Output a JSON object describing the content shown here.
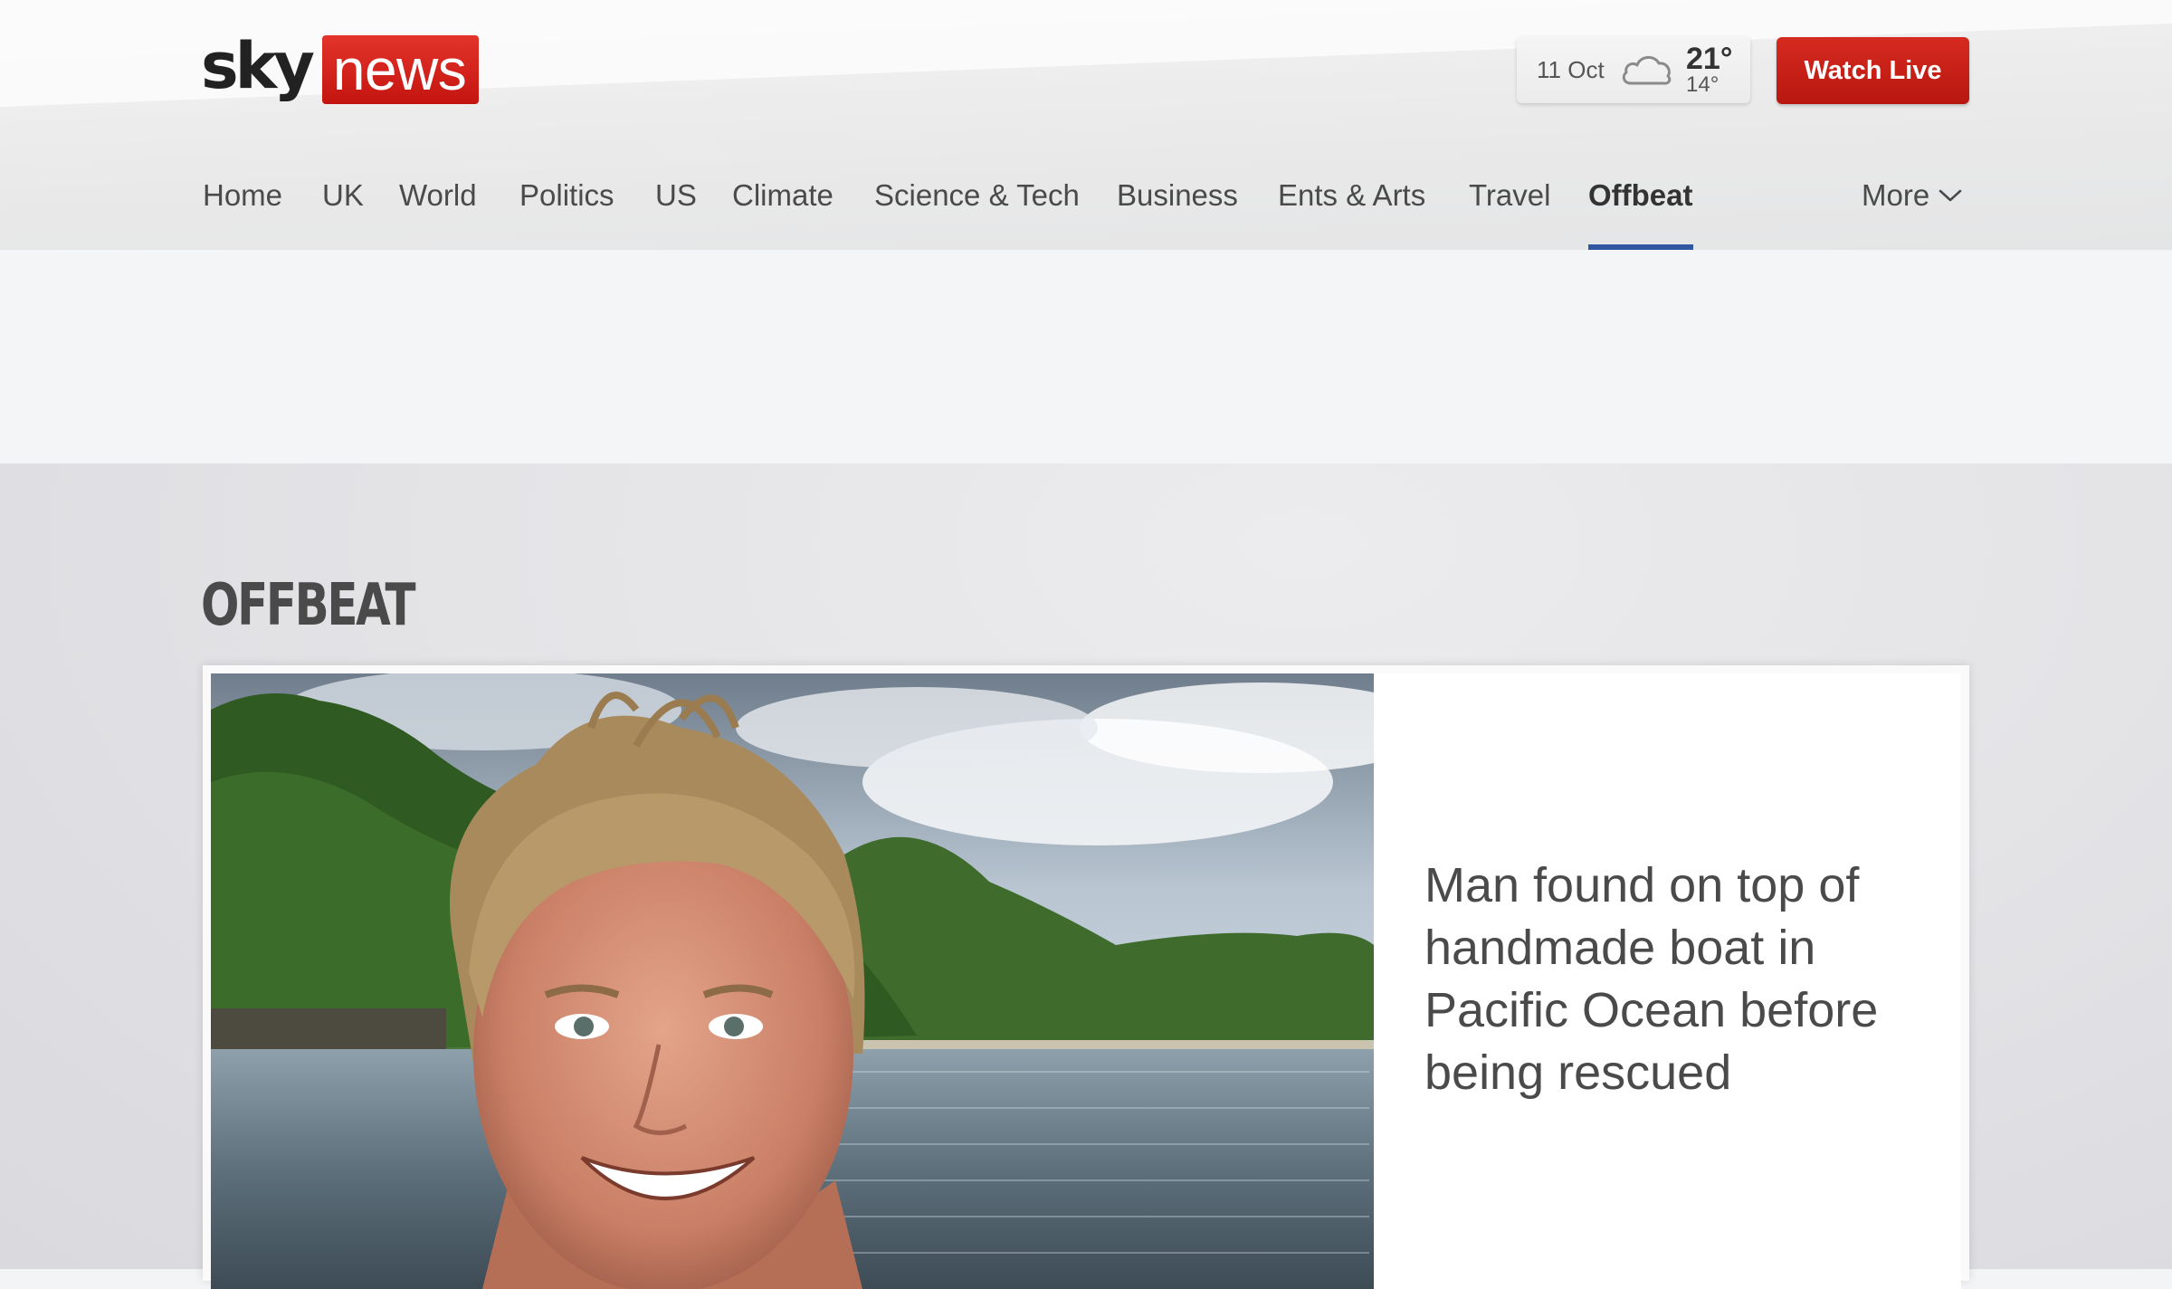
{
  "brand": {
    "part1": "sky",
    "part2": "news",
    "accent_color": "#cc1f16"
  },
  "weather": {
    "date": "11 Oct",
    "high": "21°",
    "low": "14°",
    "icon": "cloud-icon"
  },
  "watch_live": {
    "label": "Watch Live"
  },
  "nav": {
    "items": [
      {
        "label": "Home"
      },
      {
        "label": "UK"
      },
      {
        "label": "World"
      },
      {
        "label": "Politics"
      },
      {
        "label": "US"
      },
      {
        "label": "Climate"
      },
      {
        "label": "Science & Tech"
      },
      {
        "label": "Business"
      },
      {
        "label": "Ents & Arts"
      },
      {
        "label": "Travel"
      },
      {
        "label": "Offbeat"
      }
    ],
    "active_item": "Offbeat",
    "active_color": "#2f56a0",
    "more_label": "More"
  },
  "section": {
    "title": "OFFBEAT"
  },
  "lead_story": {
    "headline": "Man found on top of handmade boat in Pacific Ocean before being rescued"
  }
}
